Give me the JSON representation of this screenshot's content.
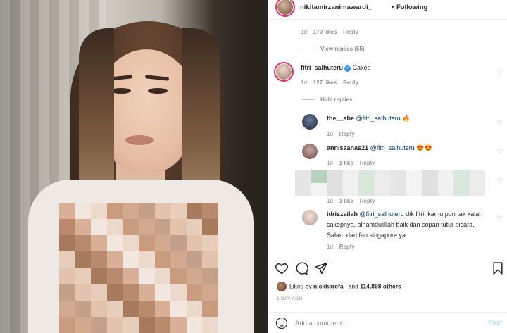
{
  "post": {
    "author": "nikitamirzanimawardi_",
    "separator": "•",
    "follow_status": "Following"
  },
  "comments": [
    {
      "time": "1d",
      "likes": "170 likes",
      "reply": "Reply",
      "view_replies": "View replies (55)"
    },
    {
      "user": "fitri_salhuteru",
      "verified": true,
      "text": "Cakep",
      "time": "1d",
      "likes": "127 likes",
      "reply": "Reply",
      "hide_replies": "Hide replies",
      "replies": [
        {
          "user": "the__abe",
          "mention": "@fitri_salhuteru",
          "text": " 🔥",
          "time": "1d",
          "reply": "Reply"
        },
        {
          "user": "annisaanas21",
          "mention": "@fitri_salhuteru",
          "text": " 😍😍",
          "time": "1d",
          "likes": "1 like",
          "reply": "Reply"
        },
        {
          "time": "1d",
          "likes": "1 like",
          "reply": "Reply"
        },
        {
          "user": "idriszailah",
          "mention": "@fitri_salhuteru",
          "text": " dik fitri, kamu pun tak kalah cakepnya, alhamdulillah baik dan sopan tutur bicara. Salam dari fan singapore ya",
          "time": "1d",
          "reply": "Reply"
        }
      ]
    }
  ],
  "likes_summary": {
    "prefix": "Liked by ",
    "user": "nickharefa_",
    "middle": " and ",
    "count": "114,898 others"
  },
  "posted_ago": "1 DAY AGO",
  "compose": {
    "placeholder": "Add a comment...",
    "post_label": "Post"
  },
  "icons": {
    "like": "heart-icon",
    "comment": "comment-icon",
    "share": "share-icon",
    "save": "bookmark-icon",
    "emoji": "emoji-icon",
    "comment_like": "small-heart-icon"
  },
  "colors": {
    "link_blue": "#00376b",
    "verified_blue": "#3897f0",
    "secondary_text": "#8e8e8e",
    "post_disabled": "#b2dffc"
  }
}
